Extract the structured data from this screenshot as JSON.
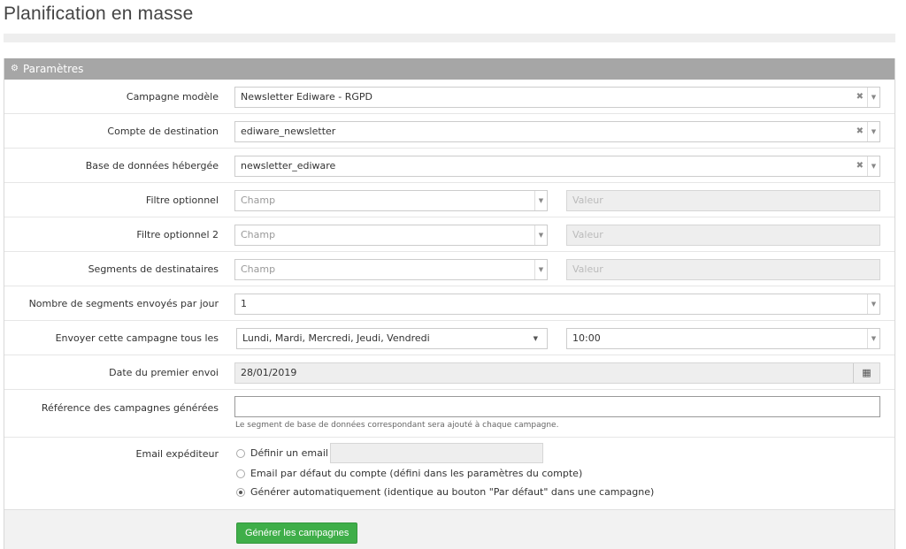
{
  "page": {
    "title": "Planification en masse"
  },
  "panel": {
    "title": "Paramètres",
    "icon": "gears-icon"
  },
  "fields": {
    "campagne_modele": {
      "label": "Campagne modèle",
      "value": "Newsletter Ediware - RGPD"
    },
    "compte_destination": {
      "label": "Compte de destination",
      "value": "ediware_newsletter"
    },
    "base_donnees": {
      "label": "Base de données hébergée",
      "value": "newsletter_ediware"
    },
    "filtre1": {
      "label": "Filtre optionnel",
      "placeholder": "Champ",
      "value_placeholder": "Valeur"
    },
    "filtre2": {
      "label": "Filtre optionnel 2",
      "placeholder": "Champ",
      "value_placeholder": "Valeur"
    },
    "segments": {
      "label": "Segments de destinataires",
      "placeholder": "Champ",
      "value_placeholder": "Valeur"
    },
    "nb_segments": {
      "label": "Nombre de segments envoyés par jour",
      "value": "1"
    },
    "envoyer": {
      "label": "Envoyer cette campagne tous les",
      "days": "Lundi, Mardi, Mercredi, Jeudi, Vendredi",
      "time": "10:00"
    },
    "date_premier": {
      "label": "Date du premier envoi",
      "value": "28/01/2019"
    },
    "reference": {
      "label": "Référence des campagnes générées",
      "value": "",
      "help": "Le segment de base de données correspondant sera ajouté à chaque campagne."
    },
    "email": {
      "label": "Email expéditeur",
      "options": [
        {
          "label": "Définir un email",
          "checked": false
        },
        {
          "label": "Email par défaut du compte (défini dans les paramètres du compte)",
          "checked": false
        },
        {
          "label": "Générer automatiquement (identique au bouton \"Par défaut\" dans une campagne)",
          "checked": true
        }
      ]
    }
  },
  "actions": {
    "generate_label": "Générer les campagnes"
  },
  "colors": {
    "header": "#a6a6a6",
    "button": "#3fae49"
  }
}
